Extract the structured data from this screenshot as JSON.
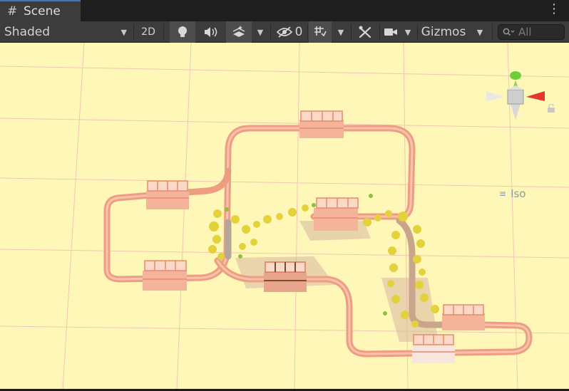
{
  "tab": {
    "title": "Scene"
  },
  "toolbar": {
    "shading_mode": "Shaded",
    "mode_2d": "2D",
    "hidden_count": "0",
    "gizmos_label": "Gizmos",
    "search_placeholder": "All"
  },
  "gizmo": {
    "projection": "Iso"
  },
  "colors": {
    "ground": "#fff7b8",
    "grid": "#f2c4b4",
    "track": "#f3a990",
    "tab_accent": "#3a79bb"
  },
  "icons": [
    "grid-icon",
    "kebab-menu-icon",
    "lightbulb-icon",
    "audio-icon",
    "effects-icon",
    "eye-hidden-icon",
    "grid-snap-icon",
    "tools-icon",
    "camera-icon",
    "search-icon",
    "lock-icon"
  ]
}
